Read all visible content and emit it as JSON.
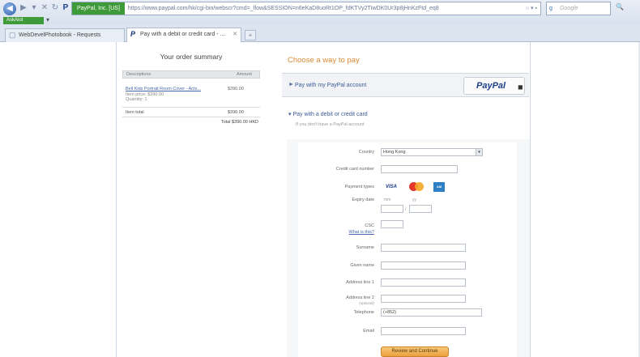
{
  "browser": {
    "site_identity": "PayPal, Inc. [US]",
    "url": "https://www.paypal.com/hk/cgi-bin/webscr?cmd=_flow&SESSION=n6eKaD8uoRt1OP_fdKTVy2TIwDK0Ur3p8jHnKzFtd_eq8",
    "search_placeholder": "Google",
    "extension_label": "AskAlot",
    "tabs": [
      {
        "title": "WebDevelPhotobook - Requests",
        "active": false
      },
      {
        "title": "Pay with a debit or credit card - ...",
        "active": true
      }
    ]
  },
  "order_summary": {
    "title": "Your order summary",
    "col_description": "Descriptions",
    "col_amount": "Amount",
    "item_name": "Bell Kids Portrait Room Cover - Acts...",
    "item_number": "Item price: $390.00",
    "item_qty": "Quantity: 1",
    "item_amount": "$390.00",
    "item_total_label": "Item total",
    "item_total_value": "$390.00",
    "total": "Total $390.00 HKD"
  },
  "payment": {
    "heading": "Choose a way to pay",
    "paypal_option": "Pay with my PayPal account",
    "paypal_logo": "PayPal",
    "card_option": "Pay with a debit or credit card",
    "card_option_sub": "If you don't have a PayPal account",
    "submit_label": "Review and Continue"
  },
  "form": {
    "country_label": "Country",
    "country_value": "Hong Kong",
    "card_number_label": "Credit card number",
    "payment_types_label": "Payment types",
    "expiry_label": "Expiry date",
    "expiry_mm": "mm",
    "expiry_yy": "yy",
    "expiry_sep": "/",
    "csc_label": "CSC",
    "csc_help": "What is this?",
    "surname_label": "Surname",
    "given_name_label": "Given name",
    "address1_label": "Address line 1",
    "address2_label": "Address line 2",
    "address2_optional": "(optional)",
    "telephone_label": "Telephone",
    "telephone_value": "(+852)",
    "email_label": "Email"
  }
}
